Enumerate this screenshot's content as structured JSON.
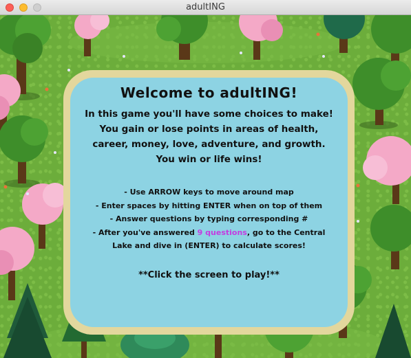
{
  "window": {
    "title": "adultING"
  },
  "welcome": {
    "title": "Welcome to adultING!",
    "intro_lines": [
      "In this game you'll have some choices to make!",
      "You gain or lose points in areas of health,",
      "career, money, love, adventure, and growth.",
      "You win or life wins!"
    ],
    "rules": [
      "- Use ARROW keys to move around map",
      "- Enter spaces by hitting ENTER when on top of them",
      "- Answer questions by typing corresponding #"
    ],
    "rule_last": {
      "prefix": "- After you've answered ",
      "highlight": "9 questions",
      "suffix": ", go to the Central",
      "line2": "Lake and dive in (ENTER) to calculate scores!"
    },
    "call_to_action": "**Click the screen to play!**"
  },
  "colors": {
    "grass": "#6cad3b",
    "panel_fill": "#8dd3e3",
    "panel_border": "#e3d79d",
    "highlight": "#c43ce0",
    "tree_green": "#3e8e2a",
    "blossom_pink": "#f4a9c7",
    "trunk_brown": "#5a3818"
  },
  "scenery_icons": [
    "green-tree-icon",
    "pink-blossom-tree-icon",
    "pine-tree-icon",
    "bush-icon",
    "flower-icon"
  ]
}
